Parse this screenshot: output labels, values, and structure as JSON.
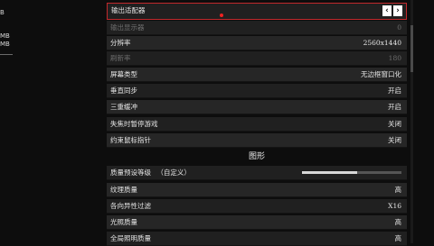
{
  "left": {
    "lines": [
      "B",
      "MB",
      "MB"
    ]
  },
  "rows_top": [
    {
      "label": "输出适配器",
      "value": "",
      "state": "selected"
    },
    {
      "label": "输出显示器",
      "value": "0",
      "state": "dim"
    },
    {
      "label": "分辨率",
      "value": "2560x1440",
      "state": "normal"
    },
    {
      "label": "刷新率",
      "value": "180",
      "state": "dim"
    },
    {
      "label": "屏幕类型",
      "value": "无边框窗口化",
      "state": "normal"
    },
    {
      "label": "垂直同步",
      "value": "开启",
      "state": "normal"
    },
    {
      "label": "三重缓冲",
      "value": "开启",
      "state": "normal"
    },
    {
      "label": "失焦时暂停游戏",
      "value": "关闭",
      "state": "normal"
    },
    {
      "label": "约束鼠标指针",
      "value": "关闭",
      "state": "normal"
    }
  ],
  "section": {
    "title": "图形"
  },
  "quality_preset": {
    "label": "质量预设等级",
    "sublabel": "（自定义）",
    "level": 0.55
  },
  "rows_bottom": [
    {
      "label": "纹理质量",
      "value": "高"
    },
    {
      "label": "各向异性过滤",
      "value": "X16"
    },
    {
      "label": "光照质量",
      "value": "高"
    },
    {
      "label": "全局照明质量",
      "value": "高"
    }
  ],
  "icons": {
    "left_arrow": "‹",
    "right_arrow": "›"
  },
  "colors": {
    "selection_border": "#c0282c",
    "background": "#0d0d0d"
  }
}
